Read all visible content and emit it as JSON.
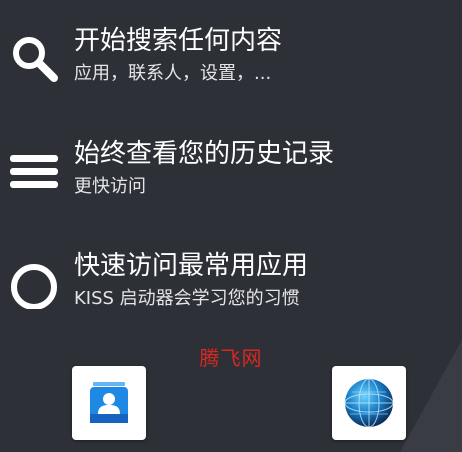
{
  "intro": {
    "items": [
      {
        "title": "开始搜索任何内容",
        "subtitle": "应用，联系人，设置，...",
        "icon": "search-icon"
      },
      {
        "title": "始终查看您的历史记录",
        "subtitle": "更快访问",
        "icon": "menu-icon"
      },
      {
        "title": "快速访问最常用应用",
        "subtitle": "KISS 启动器会学习您的习惯",
        "icon": "circle-icon"
      }
    ]
  },
  "watermark": {
    "text": "腾飞网"
  },
  "favorites": {
    "apps": [
      {
        "icon": "contacts-app-icon"
      },
      {
        "icon": "globe-browser-app-icon"
      }
    ]
  },
  "colors": {
    "background": "#2e3038",
    "text": "#ffffff",
    "subtitle": "#e4e5ea",
    "watermark": "#d9281f",
    "contacts_blue": "#1e88e5"
  }
}
